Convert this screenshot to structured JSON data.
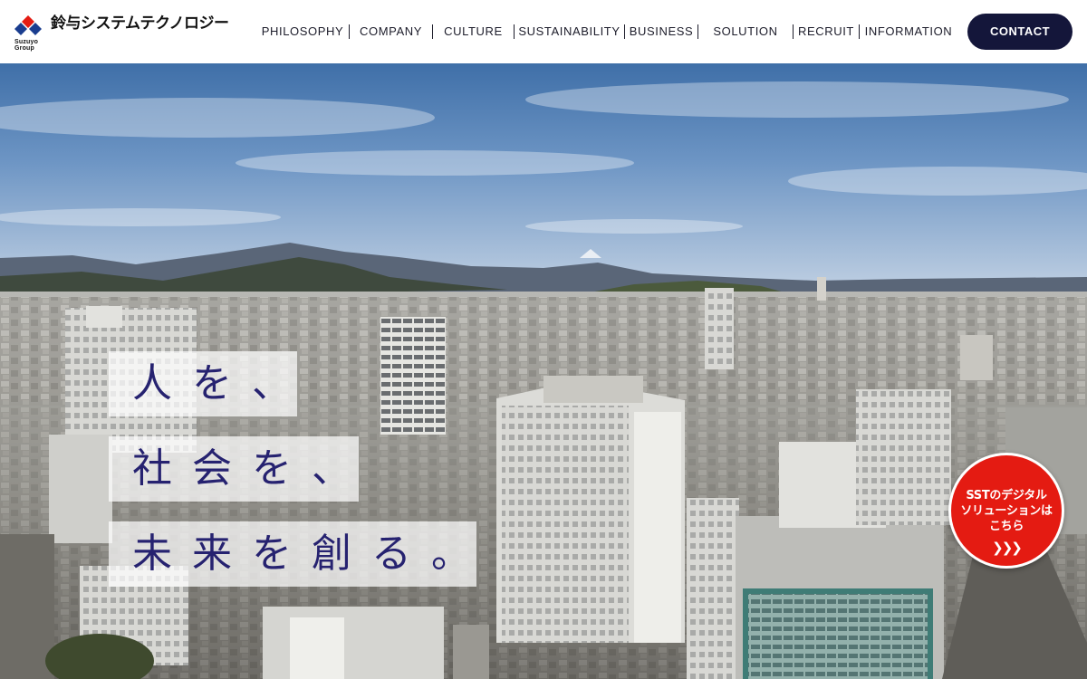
{
  "brand": {
    "name": "鈴与システムテクノロジー",
    "group": "Suzuyo Group",
    "colors": {
      "red": "#e41b12",
      "blue": "#1a3d8f",
      "navy": "#14163a"
    }
  },
  "nav": {
    "items": [
      {
        "label": "PHILOSOPHY"
      },
      {
        "label": "COMPANY"
      },
      {
        "label": "CULTURE"
      },
      {
        "label": "SUSTAINABILITY"
      },
      {
        "label": "BUSINESS"
      },
      {
        "label": "SOLUTION"
      },
      {
        "label": "RECRUIT"
      },
      {
        "label": "INFORMATION"
      }
    ],
    "contact_label": "CONTACT"
  },
  "hero": {
    "tagline": [
      "人を、",
      "社会を、",
      "未来を創る。"
    ],
    "badge": {
      "lines": [
        "SSTのデジタル",
        "ソリューションは",
        "こちら"
      ],
      "arrows": "❯❯❯"
    }
  }
}
